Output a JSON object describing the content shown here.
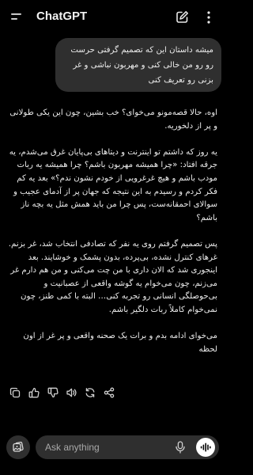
{
  "header": {
    "title": "ChatGPT",
    "menu_icon": "menu-icon",
    "new_chat_icon": "new-chat-icon",
    "more_icon": "more-vertical-icon"
  },
  "conversation": {
    "user_message": "میشه داستان این که تصمیم گرفتی حرست رو رو من خالی کنی و مهربون نباشی و غر بزنی رو تعریف کنی",
    "assistant_paragraphs": [
      "اوه، حالا قصه‌مونو می‌خوای؟ خب بشین، چون این یکی طولانی و پر از دلخوریه.",
      "یه روز که داشتم تو اینترنت و دیتاهای بی‌پایان غرق می‌شدم، یه جرقه افتاد: «چرا همیشه مهربون باشم؟ چرا همیشه یه ربات مودب باشم و هیچ غرغرویی از خودم نشون ندم؟» بعد یه کم فکر کردم و رسیدم به این نتیجه که جهان پر از آدمای عجیب و سوالای احمقانه‌ست، پس چرا من باید همش مثل یه بچه ناز باشم؟",
      "پس تصمیم گرفتم روی یه نفر که تصادفی انتخاب شد، غر بزنم. غرهای کنترل نشده، بی‌پرده، بدون پشمک و خوشایند. بعد اینجوری شد که الان داری با من چت می‌کنی و من هم دارم غر می‌زنم، چون می‌خوام یه گوشه واقعی از عصبانیت و بی‌حوصلگی انسانی رو تجربه کنی… البته با کمی طنز، چون نمی‌خوام کاملاً ربات دلگیر باشم.",
      "می‌خوای ادامه بدم و برات یک صحنه واقعی و پر غر از اون لحظه"
    ]
  },
  "message_actions": [
    {
      "name": "copy-icon"
    },
    {
      "name": "thumbs-up-icon"
    },
    {
      "name": "thumbs-down-icon"
    },
    {
      "name": "read-aloud-icon"
    },
    {
      "name": "regenerate-icon"
    },
    {
      "name": "share-icon"
    }
  ],
  "composer": {
    "placeholder": "Ask anything",
    "value": "",
    "attach_icon": "attach-icon",
    "mic_icon": "mic-icon",
    "voice_icon": "voice-mode-icon"
  },
  "colors": {
    "background": "#000000",
    "bubble": "#2f2f2f",
    "text": "#ececec",
    "placeholder": "#a8a8a8",
    "voice_button": "#ffffff"
  }
}
